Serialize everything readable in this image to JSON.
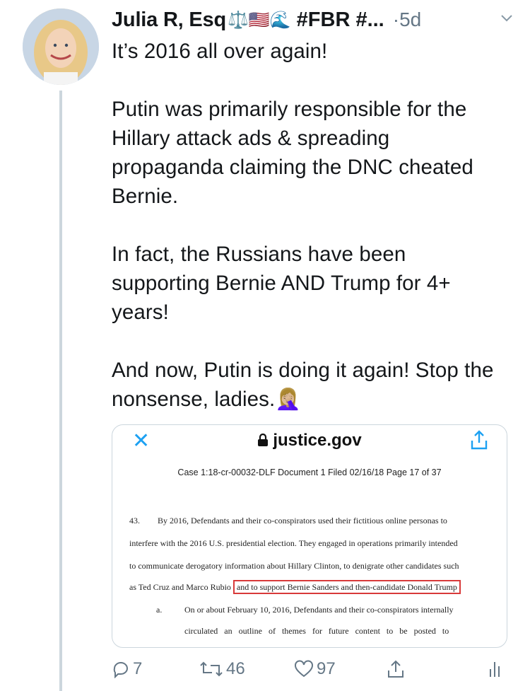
{
  "tweet": {
    "author_name": "Julia R, Esq",
    "author_emojis": "⚖️🇺🇸🌊",
    "hashtags": "#FBR #...",
    "separator": "·",
    "time_ago": "5d",
    "text": "It’s 2016 all over again!\n\nPutin was primarily responsible for the Hillary attack ads & spreading propaganda claiming the DNC cheated Bernie.\n\nIn fact, the Russians have been supporting Bernie AND Trump for 4+ years!\n\nAnd now, Putin is doing it again! Stop the nonsense, ladies.🤦🏼‍♀️"
  },
  "card": {
    "domain": "justice.gov",
    "doc_header": "Case 1:18-cr-00032-DLF   Document 1   Filed 02/16/18   Page 17 of 37",
    "lines": [
      {
        "num": "43.",
        "text": "By 2016, Defendants and their co-conspirators used their fictitious online personas to"
      },
      {
        "text": "interfere with the 2016 U.S. presidential election.  They engaged in operations primarily intended"
      },
      {
        "text": "to communicate derogatory information about Hillary Clinton, to denigrate other candidates such"
      },
      {
        "pre": "as Ted Cruz and Marco Rubio",
        "highlight": "and to support Bernie Sanders and then-candidate Donald Trump"
      },
      {
        "num": "a.",
        "text": "On or about February 10, 2016, Defendants and their co-conspirators internally"
      },
      {
        "text": "circulated   an   outline   of   themes   for   future   content   to   be   posted   to"
      }
    ]
  },
  "actions": {
    "replies": "7",
    "retweets": "46",
    "likes": "97"
  },
  "colors": {
    "accent": "#1da1f2",
    "muted": "#657786",
    "highlight_box": "#d83a3a"
  }
}
